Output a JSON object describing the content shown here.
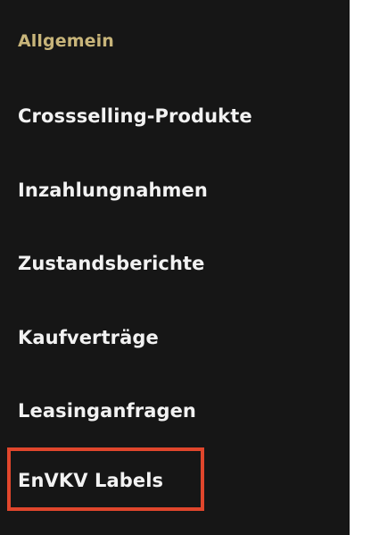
{
  "menu": {
    "items": [
      {
        "label": "Allgemein",
        "active": true
      },
      {
        "label": "Crossselling-Produkte",
        "active": false
      },
      {
        "label": "Inzahlungnahmen",
        "active": false
      },
      {
        "label": "Zustandsberichte",
        "active": false
      },
      {
        "label": "Kaufverträge",
        "active": false
      },
      {
        "label": "Leasinganfragen",
        "active": false
      },
      {
        "label": "EnVKV Labels",
        "active": false
      }
    ]
  },
  "colors": {
    "background": "#161616",
    "text": "#f2f2f2",
    "active_text": "#c8b57a",
    "highlight_border": "#e0462c"
  }
}
